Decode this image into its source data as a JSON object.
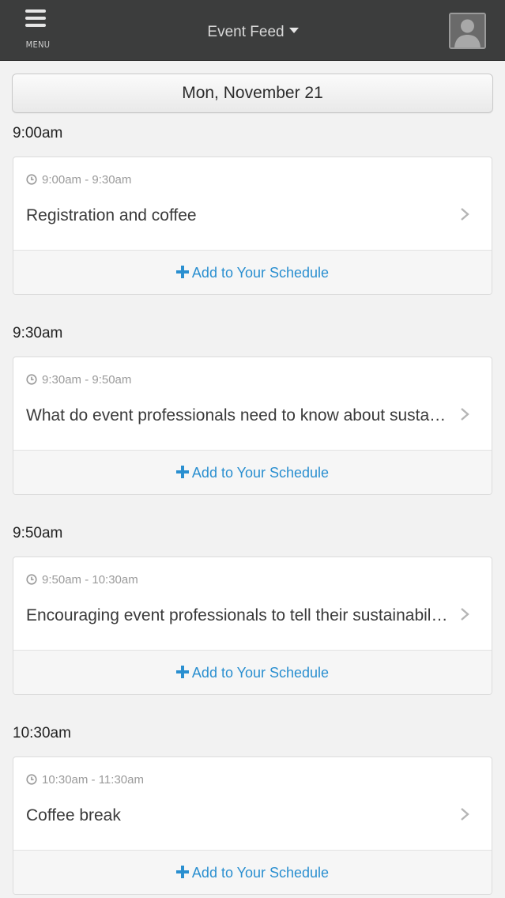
{
  "header": {
    "menu_label": "MENU",
    "title": "Event Feed"
  },
  "date_selector": {
    "label": "Mon, November 21"
  },
  "colors": {
    "topbar": "#3c3d3d",
    "accent": "#2a8fd0",
    "background": "#f2f2f2"
  },
  "icons": [
    "hamburger-menu-icon",
    "caret-down-icon",
    "user-avatar-icon",
    "clock-icon",
    "chevron-right-icon",
    "plus-icon"
  ],
  "sessions": [
    {
      "heading": "9:00am",
      "time_range": "9:00am - 9:30am",
      "title": "Registration and coffee",
      "action": "Add to Your Schedule"
    },
    {
      "heading": "9:30am",
      "time_range": "9:30am - 9:50am",
      "title": "What do event professionals need to know about sustainability?",
      "action": "Add to Your Schedule"
    },
    {
      "heading": "9:50am",
      "time_range": "9:50am - 10:30am",
      "title": "Encouraging event professionals to tell their sustainability stories",
      "action": "Add to Your Schedule"
    },
    {
      "heading": "10:30am",
      "time_range": "10:30am - 11:30am",
      "title": "Coffee break",
      "action": "Add to Your Schedule"
    }
  ]
}
